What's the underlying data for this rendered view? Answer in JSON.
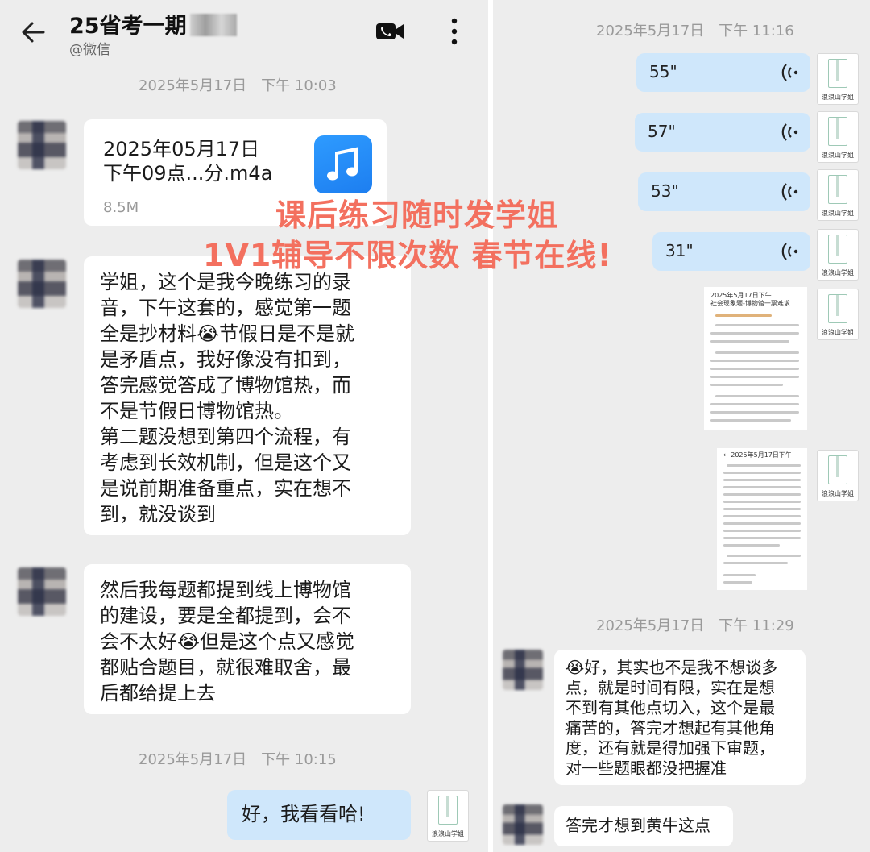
{
  "left": {
    "header": {
      "title": "25省考一期",
      "subtitle": "@微信"
    },
    "timestamps": [
      "2025年5月17日　下午 10:03",
      "2025年5月17日　下午 10:15"
    ],
    "file_message": {
      "name": "2025年05月17日\n下午09点...分.m4a",
      "size": "8.5M"
    },
    "messages": [
      {
        "text": "学姐，这个是我今晚练习的录\n音，下午这套的，感觉第一题\n全是抄材料😭节假日是不是就\n是矛盾点，我好像没有扣到，\n答完感觉答成了博物馆热，而\n不是节假日博物馆热。\n第二题没想到第四个流程，有\n考虑到长效机制，但是这个又\n是说前期准备重点，实在想不\n到，就没谈到"
      },
      {
        "text": "然后我每题都提到线上博物馆\n的建设，要是全都提到，会不\n会不太好😭但是这个点又感觉\n都贴合题目，就很难取舍，最\n后都给提上去"
      }
    ],
    "reply": "好，我看看哈!",
    "brand_label": "浪浪山学姐"
  },
  "right": {
    "timestamps": [
      "2025年5月17日　下午 11:16",
      "2025年5月17日　下午 11:29"
    ],
    "voice_messages": [
      {
        "duration": "55\""
      },
      {
        "duration": "57\""
      },
      {
        "duration": "53\""
      },
      {
        "duration": "31\""
      }
    ],
    "image_1": {
      "title": "2025年5月17日下午\n社会现象题-博物馆一票难求"
    },
    "image_2": {
      "title": "← 2025年5月17日下午"
    },
    "messages": [
      {
        "text": "😭好，其实也不是我不想谈多\n点，就是时间有限，实在是想\n不到有其他点切入，这个是最\n痛苦的，答完才想起有其他角\n度，还有就是得加强下审题，\n对一些题眼都没把握准"
      },
      {
        "text": "答完才想到黄牛这点"
      }
    ],
    "brand_label": "浪浪山学姐"
  },
  "overlay": {
    "line1": "课后练习随时发学姐",
    "line2": "1V1辅导不限次数 春节在线!"
  },
  "colors": {
    "background": "#ededed",
    "bubble_mine": "#cfe7fb",
    "bubble_other": "#ffffff",
    "overlay_text": "#f3705f",
    "music_tile": "#1d7ef0"
  },
  "icons": [
    "back-arrow-icon",
    "video-call-icon",
    "more-vertical-icon",
    "music-note-icon",
    "voice-wave-icon"
  ]
}
